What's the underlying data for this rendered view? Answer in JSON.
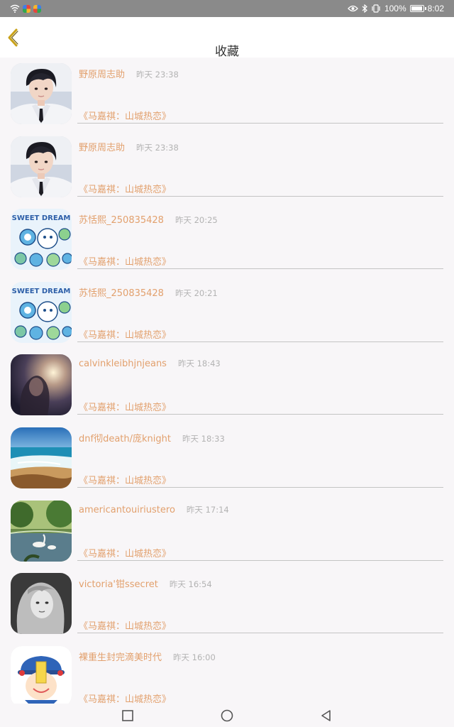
{
  "status_bar": {
    "battery": "100%",
    "time": "8:02",
    "battery_level": 1.0
  },
  "header": {
    "title": "收藏"
  },
  "items": [
    {
      "name": "野原周志助",
      "time": "昨天 23:38",
      "book": "《马嘉祺：山城热恋》",
      "avatar": "boy-portrait"
    },
    {
      "name": "野原周志助",
      "time": "昨天 23:38",
      "book": "《马嘉祺：山城热恋》",
      "avatar": "boy-portrait"
    },
    {
      "name": "苏恬熙_250835428",
      "time": "昨天 20:25",
      "book": "《马嘉祺：山城热恋》",
      "avatar": "sweet-dream"
    },
    {
      "name": "苏恬熙_250835428",
      "time": "昨天 20:21",
      "book": "《马嘉祺：山城热恋》",
      "avatar": "sweet-dream"
    },
    {
      "name": "calvinkleibhjnjeans",
      "time": "昨天 18:43",
      "book": "《马嘉祺：山城热恋》",
      "avatar": "dark-portrait"
    },
    {
      "name": "dnf彻death/庞knight",
      "time": "昨天 18:33",
      "book": "《马嘉祺：山城热恋》",
      "avatar": "beach"
    },
    {
      "name": "americantouiriustero",
      "time": "昨天 17:14",
      "book": "《马嘉祺：山城热恋》",
      "avatar": "swan-lake"
    },
    {
      "name": "victoria'钳ssecret",
      "time": "昨天 16:54",
      "book": "《马嘉祺：山城热恋》",
      "avatar": "girl-bw"
    },
    {
      "name": "裸重生封完滴美时代",
      "time": "昨天 16:00",
      "book": "《马嘉祺：山城热恋》",
      "avatar": "cartoon"
    }
  ],
  "avatar_text": {
    "sweet_dream": "SWEET DREAM"
  },
  "colors": {
    "accent": "#e2a06d",
    "time": "#b3b3b3",
    "back_arrow": "#c9a21a",
    "status_bar": "#8a8a8a"
  }
}
